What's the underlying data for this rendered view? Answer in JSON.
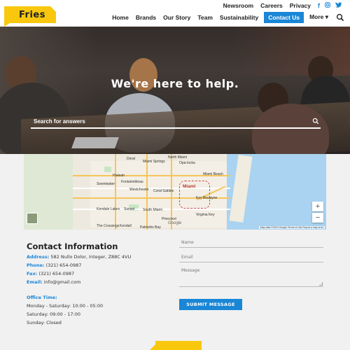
{
  "brand": {
    "logo_text": "Fries",
    "logo_color": "#f9c80e"
  },
  "topnav": {
    "links": [
      "Newsroom",
      "Careers",
      "Privacy"
    ],
    "social_icons": [
      "facebook-icon",
      "instagram-icon",
      "twitter-icon"
    ]
  },
  "mainnav": {
    "items": [
      "Home",
      "Brands",
      "Our Story",
      "Team",
      "Sustainability",
      "Contact Us",
      "More ▾"
    ],
    "active": "Contact Us",
    "accent": "#1a86d6"
  },
  "hero": {
    "title": "We're here to help.",
    "search_placeholder": "Search for answers"
  },
  "map": {
    "miami_label": "Miami",
    "places": [
      "Doral",
      "Miami Springs",
      "Hialeah",
      "Opa-locka",
      "Miami Beach",
      "Sweetwater",
      "Fontainebleau",
      "Westchester",
      "Coral Gables",
      "Key Biscayne",
      "Kendale Lakes",
      "Sunset",
      "South Miami",
      "Pinecrest",
      "The Crossings",
      "Kendall",
      "Palmetto Bay",
      "Virginia Key",
      "North Miami"
    ],
    "zoom_in": "+",
    "zoom_out": "−",
    "google_label": "Google",
    "attribution": "Map data ©2019 Google   Terms of Use   Report a map error"
  },
  "contact": {
    "title": "Contact Information",
    "address_label": "Address:",
    "address": "582 Nullo Dolor, Integer, Z88C 4VU",
    "phone_label": "Phone:",
    "phone": "(321) 654-0987",
    "fax_label": "Fax:",
    "fax": "(321) 654-0987",
    "email_label": "Email:",
    "email": "info@gmail.com",
    "hours_title": "Office Time:",
    "hours": [
      "Monday - Saturday: 10:00 - 05:00",
      "Saturday: 09:00 - 17:00",
      "Sunday: Closed"
    ]
  },
  "form": {
    "name_placeholder": "Name",
    "email_placeholder": "Email",
    "message_placeholder": "Message",
    "submit_label": "SUBMIT MESSAGE"
  }
}
